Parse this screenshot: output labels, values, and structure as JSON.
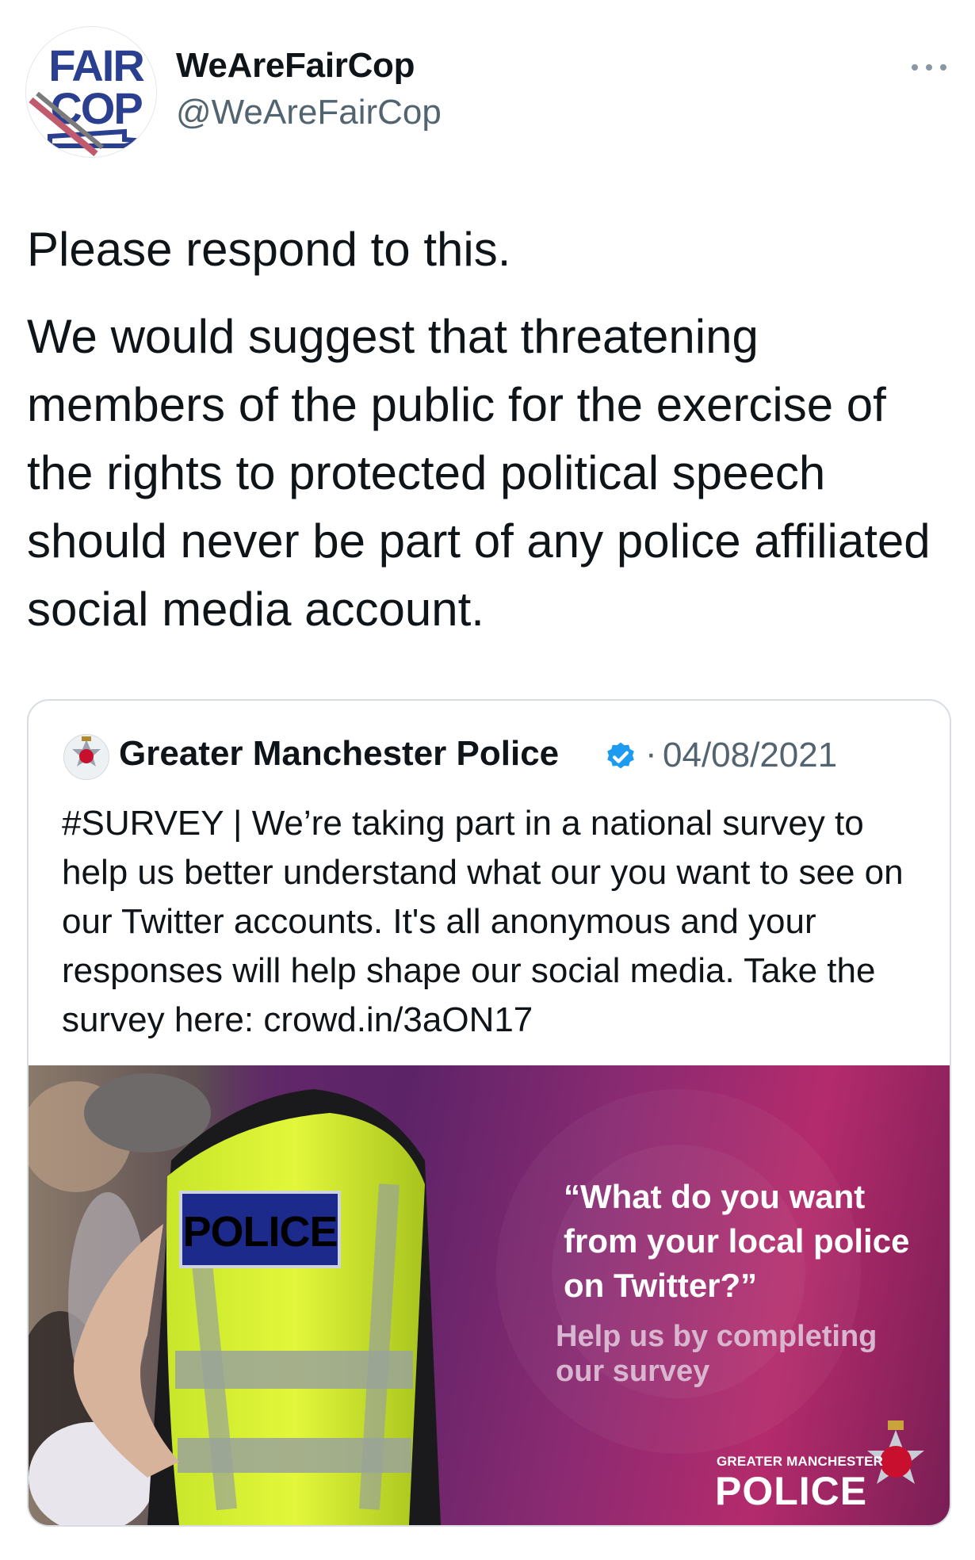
{
  "author": {
    "display_name": "WeAreFairCop",
    "handle": "@WeAreFairCop",
    "avatar_logo_line1": "FAIR",
    "avatar_logo_line2": "COP",
    "more_icon": "more-horizontal-icon"
  },
  "tweet": {
    "paragraphs": [
      "Please respond to this.",
      "We would suggest that threatening members of the public for the exercise of the rights to protected political speech should never be part of any police affiliated social media account."
    ]
  },
  "quoted_tweet": {
    "author_name": "Greater Manchester Police",
    "verified_icon": "verified-badge-icon",
    "separator": "·",
    "date": "04/08/2021",
    "text": "#SURVEY | We’re taking part in a national survey to help us better understand what our you want to see on our Twitter accounts. It's all anonymous and your responses will help shape our social media. Take the survey here: crowd.in/3aON17",
    "media": {
      "headline": "“What do you want from your local police on Twitter?”",
      "subtext": "Help us by completing our survey",
      "vest_label": "POLICE",
      "brand_small": "GREATER MANCHESTER",
      "brand_big": "POLICE",
      "colors": {
        "vest": "#d4ef2c",
        "background_magenta": "#b42b6c",
        "background_purple": "#5c2367"
      }
    }
  },
  "colors": {
    "text": "#0f1419",
    "secondary_text": "#536471",
    "verified_blue": "#1d9bf0",
    "card_border": "#d7dde2"
  }
}
